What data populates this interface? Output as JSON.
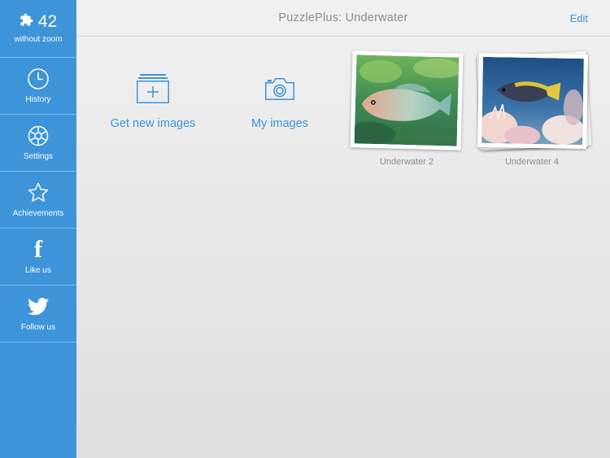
{
  "sidebar": {
    "score": {
      "value": "42",
      "label": "without zoom"
    },
    "items": [
      {
        "label": "History",
        "icon": "clock-icon"
      },
      {
        "label": "Settings",
        "icon": "gear-icon"
      },
      {
        "label": "Achievements",
        "icon": "star-icon"
      },
      {
        "label": "Like us",
        "icon": "facebook-icon",
        "glyph": "f"
      },
      {
        "label": "Follow us",
        "icon": "twitter-icon"
      }
    ]
  },
  "header": {
    "title": "PuzzlePlus: Underwater",
    "edit_label": "Edit"
  },
  "actions": [
    {
      "label": "Get new images",
      "icon": "add-image-icon"
    },
    {
      "label": "My images",
      "icon": "camera-icon"
    }
  ],
  "puzzles": [
    {
      "label": "Underwater 2"
    },
    {
      "label": "Underwater 4"
    }
  ],
  "colors": {
    "accent": "#3d94d9",
    "background": "#eaeaea",
    "caption": "#8c8c8c"
  }
}
